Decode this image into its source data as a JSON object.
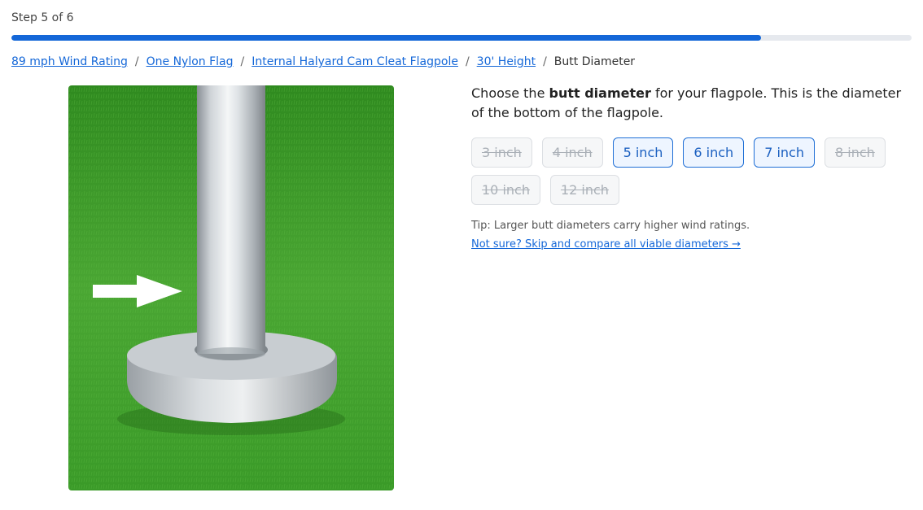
{
  "step": {
    "label": "Step 5 of 6",
    "progress": 0.833
  },
  "breadcrumb": {
    "items": [
      "89 mph Wind Rating",
      "One Nylon Flag",
      "Internal Halyard Cam Cleat Flagpole",
      "30' Height"
    ],
    "current": "Butt Diameter",
    "separator": "/"
  },
  "image": {
    "alt": "Flagpole base on grass with arrow pointing to the bottom of the pole",
    "icon": "arrow-right-icon"
  },
  "question": {
    "prefix": "Choose the ",
    "bold": "butt diameter",
    "suffix": " for your flagpole. This is the diameter of the bottom of the flagpole."
  },
  "options": [
    {
      "label": "3 inch",
      "available": false
    },
    {
      "label": "4 inch",
      "available": false
    },
    {
      "label": "5 inch",
      "available": true
    },
    {
      "label": "6 inch",
      "available": true
    },
    {
      "label": "7 inch",
      "available": true
    },
    {
      "label": "8 inch",
      "available": false
    },
    {
      "label": "10 inch",
      "available": false
    },
    {
      "label": "12 inch",
      "available": false
    }
  ],
  "tip": "Tip: Larger butt diameters carry higher wind ratings.",
  "skip_link": "Not sure? Skip and compare all viable diameters →",
  "colors": {
    "accent": "#1467d8",
    "track": "#e6e9ee",
    "grass": "#3f9a2c"
  }
}
